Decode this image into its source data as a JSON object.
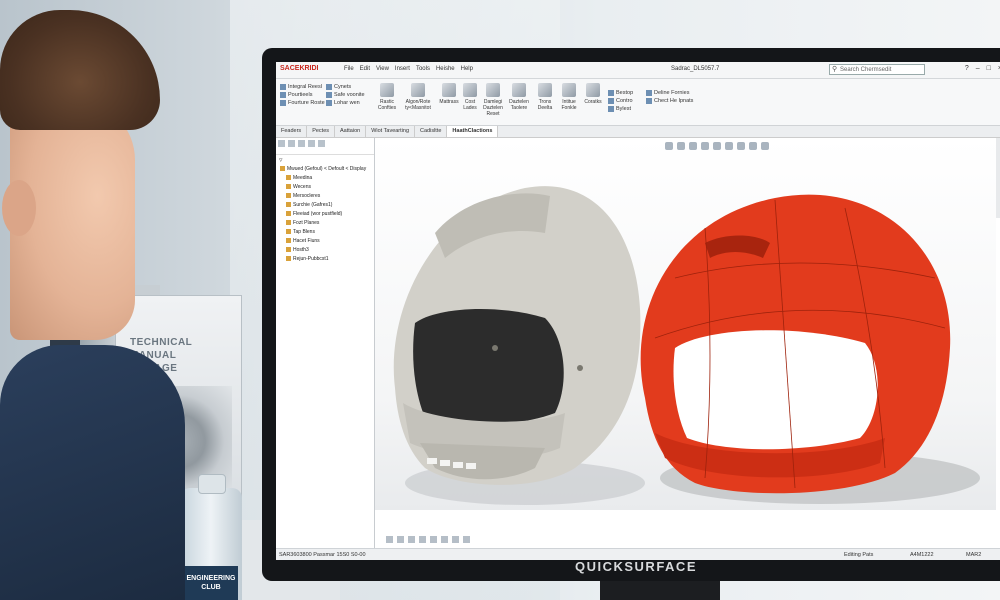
{
  "background": {
    "book_title": [
      "TECHNICAL MANUAL",
      "MANAGE"
    ],
    "bottle_label": [
      "ENGINEERING",
      "CLUB"
    ]
  },
  "monitor": {
    "brand": "QUICKSURFACE"
  },
  "app": {
    "logo": "SACEKRIDI",
    "menus": [
      "File",
      "Edit",
      "View",
      "Insert",
      "Tools",
      "Heishe",
      "Help"
    ],
    "document_title": "Sadrac_DL5057.7",
    "search_placeholder": "Search Chermsedit",
    "window_controls": [
      "?",
      "–",
      "□",
      "×"
    ]
  },
  "ribbon": {
    "left_group": [
      "Integral Reesl",
      "Pourtieels",
      "Fourture Roste"
    ],
    "second_group": [
      "Cynets",
      "Safe voonite",
      "Lohar wen"
    ],
    "tools": [
      "Rastic Confties",
      "Algon/Rote ty<Masnitot",
      "Mattrass",
      "Cost Lades",
      "Damlegi Daztelen Reset",
      "Daztelen Taolere",
      "Trons Deelta",
      "Intitue Fonkle",
      "Coratks"
    ],
    "right_group": [
      "Bestop",
      "Contro",
      "Bylest"
    ],
    "right_group2": [
      "Deline Fornies",
      "Chect He Ipnats"
    ]
  },
  "tabs": [
    "Feaders",
    "Pectes",
    "Aattaion",
    "Wiot Tavearting",
    "Cadisltte",
    "HaathClactions"
  ],
  "tree": {
    "nodes": [
      {
        "label": "Mwued (Gefoul) < Defoult < Display",
        "level": 1
      },
      {
        "label": "Meedina",
        "level": 2
      },
      {
        "label": "Wecens",
        "level": 2
      },
      {
        "label": "Mersocleres",
        "level": 2
      },
      {
        "label": "Surchie (Gafres1)",
        "level": 2
      },
      {
        "label": "Fleeiad (wor pustfield)",
        "level": 2
      },
      {
        "label": "Fozt Planes",
        "level": 2
      },
      {
        "label": "Tap Blens",
        "level": 2
      },
      {
        "label": "Hacet Fiuns",
        "level": 2
      },
      {
        "label": "Hosth3",
        "level": 2
      },
      {
        "label": "Rejun-Pubbcst1",
        "level": 2
      }
    ]
  },
  "statusbar": {
    "left": "SAR3603800 Passmar 15S0 S0-00",
    "editing": "Editing Pats",
    "units": "A4M1222",
    "right": "MAR2"
  },
  "colors": {
    "helmet_grey": "#cfcdc6",
    "helmet_red": "#e03a1c",
    "app_accent": "#c8281e"
  }
}
